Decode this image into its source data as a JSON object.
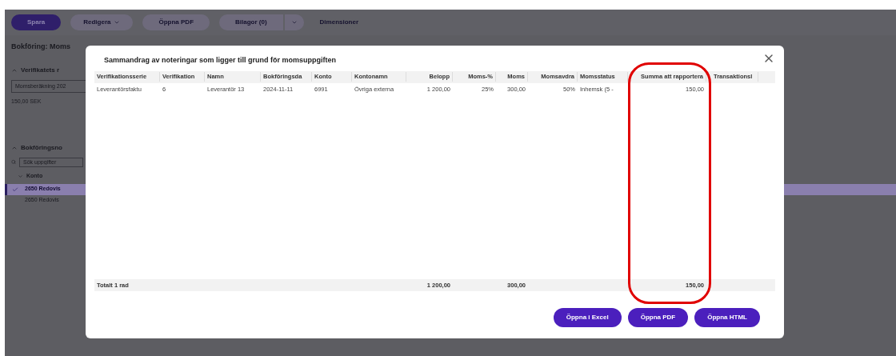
{
  "toolbar": {
    "buttons": [
      {
        "label": "Spara",
        "kind": "primary"
      },
      {
        "label": "Redigera",
        "kind": "dropdown"
      },
      {
        "label": "Öppna PDF",
        "kind": "plain"
      },
      {
        "label": "Bilagor (0)",
        "kind": "split"
      },
      {
        "label": "Dimensioner",
        "kind": "link"
      }
    ]
  },
  "page_title": "Bokföring: Moms",
  "sections": [
    {
      "title": "Verifikatets r"
    },
    {
      "title": "Bokföringsno"
    }
  ],
  "voucher": {
    "field_value": "Momsberäkning 202",
    "amount": "150,00 SEK"
  },
  "entries": {
    "search": {
      "placeholder": "Sök uppgifter"
    },
    "group": "Konto",
    "rows": [
      {
        "label": "2650 Redovis",
        "selected": true
      },
      {
        "label": "2650 Redovis",
        "selected": false
      }
    ]
  },
  "dialog": {
    "title": "Sammandrag av noteringar som ligger till grund för momsuppgiften",
    "columns": [
      "Verifikationsserie",
      "Verifikation",
      "Namn",
      "Bokföringsda",
      "Konto",
      "Kontonamn",
      "Belopp",
      "Moms-%",
      "Moms",
      "Momsavdra",
      "Momsstatus",
      "Summa att rapportera",
      "Transaktionsl"
    ],
    "rows": [
      [
        "Leverantörsfaktu",
        "6",
        "Leverantör 13",
        "2024-11-11",
        "6991",
        "Övriga externa",
        "1 200,00",
        "25%",
        "300,00",
        "50%",
        "Inhemsk (5 -",
        "150,00",
        ""
      ]
    ],
    "total": {
      "label": "Totalt 1 rad",
      "amount": "1 200,00",
      "vat": "300,00",
      "to_report": "150,00"
    },
    "buttons": [
      "Öppna i Excel",
      "Öppna PDF",
      "Öppna HTML"
    ]
  }
}
